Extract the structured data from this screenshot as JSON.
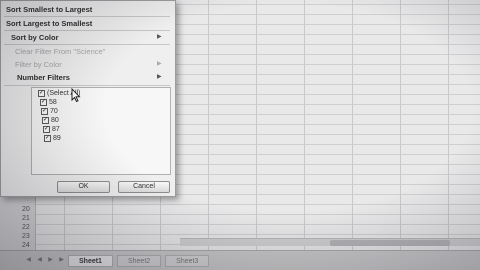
{
  "sort_menu": {
    "sort_asc": "Sort Smallest to Largest",
    "sort_desc": "Sort Largest to Smallest",
    "sort_by_color": "Sort by Color",
    "clear_filter": "Clear Filter From \"Science\"",
    "filter_by_color": "Filter by Color",
    "number_filters": "Number Filters"
  },
  "filter_values": [
    {
      "label": "(Select All)",
      "checked": true
    },
    {
      "label": "58",
      "checked": true
    },
    {
      "label": "70",
      "checked": true
    },
    {
      "label": "80",
      "checked": true
    },
    {
      "label": "87",
      "checked": true
    },
    {
      "label": "89",
      "checked": true
    }
  ],
  "buttons": {
    "ok": "OK",
    "cancel": "Cancel"
  },
  "row_numbers": [
    "20",
    "21",
    "22",
    "23",
    "24"
  ],
  "sheet_tabs": [
    "Sheet1",
    "Sheet2",
    "Sheet3"
  ],
  "colors": {
    "menu_bg": "#efefef",
    "sheet_bg": "#e9e9ea",
    "gridline": "#c9c9cb"
  }
}
